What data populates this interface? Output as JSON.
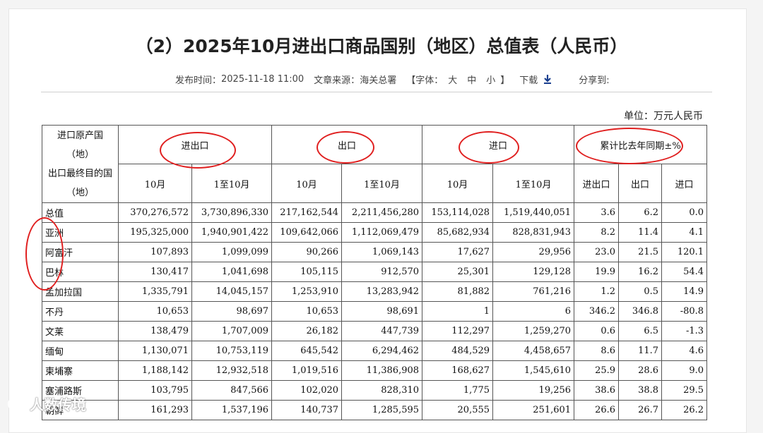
{
  "page": {
    "title": "（2）2025年10月进出口商品国别（地区）总值表（人民币）",
    "meta": {
      "publish_label": "发布时间：",
      "publish_time": "2025-11-18 11:00",
      "source_label": "文章来源：",
      "source": "海关总署",
      "font_label": "【字体：",
      "font_large": "大",
      "font_medium": "中",
      "font_small": "小",
      "font_close": "】",
      "download_label": "下载",
      "share_label": "分享到:"
    },
    "unit": "单位：万元人民币"
  },
  "table": {
    "corner_header": [
      "进口原产国",
      "（地）",
      "出口最终目的国",
      "（地）"
    ],
    "group_headers": [
      "进出口",
      "出口",
      "进口",
      "累计比去年同期±%"
    ],
    "sub_headers": [
      "10月",
      "1至10月",
      "10月",
      "1至10月",
      "10月",
      "1至10月",
      "进出口",
      "出口",
      "进口"
    ],
    "rows": [
      [
        "总值",
        "370,276,572",
        "3,730,896,330",
        "217,162,544",
        "2,211,456,280",
        "153,114,028",
        "1,519,440,051",
        "3.6",
        "6.2",
        "0.0"
      ],
      [
        "亚洲",
        "195,325,000",
        "1,940,901,422",
        "109,642,066",
        "1,112,069,479",
        "85,682,934",
        "828,831,943",
        "8.2",
        "11.4",
        "4.1"
      ],
      [
        "阿富汗",
        "107,893",
        "1,099,099",
        "90,266",
        "1,069,143",
        "17,627",
        "29,956",
        "23.0",
        "21.5",
        "120.1"
      ],
      [
        "巴林",
        "130,417",
        "1,041,698",
        "105,115",
        "912,570",
        "25,301",
        "129,128",
        "19.9",
        "16.2",
        "54.4"
      ],
      [
        "孟加拉国",
        "1,335,791",
        "14,045,157",
        "1,253,910",
        "13,283,942",
        "81,882",
        "761,216",
        "1.2",
        "0.5",
        "14.9"
      ],
      [
        "不丹",
        "10,653",
        "98,697",
        "10,653",
        "98,691",
        "1",
        "6",
        "346.2",
        "346.8",
        "-80.8"
      ],
      [
        "文莱",
        "138,479",
        "1,707,009",
        "26,182",
        "447,739",
        "112,297",
        "1,259,270",
        "0.6",
        "6.5",
        "-1.3"
      ],
      [
        "缅甸",
        "1,130,071",
        "10,753,119",
        "645,542",
        "6,294,462",
        "484,529",
        "4,458,657",
        "8.6",
        "11.7",
        "4.6"
      ],
      [
        "柬埔寨",
        "1,188,142",
        "12,932,518",
        "1,019,516",
        "11,386,908",
        "168,627",
        "1,545,610",
        "25.9",
        "28.6",
        "9.0"
      ],
      [
        "塞浦路斯",
        "103,795",
        "847,566",
        "102,020",
        "828,310",
        "1,775",
        "19,256",
        "38.6",
        "38.8",
        "29.5"
      ],
      [
        "朝鲜",
        "161,293",
        "1,537,196",
        "140,737",
        "1,285,595",
        "20,555",
        "251,601",
        "26.6",
        "26.7",
        "26.2"
      ]
    ]
  },
  "watermark": "人数传境",
  "annotation_color": "#e02020"
}
